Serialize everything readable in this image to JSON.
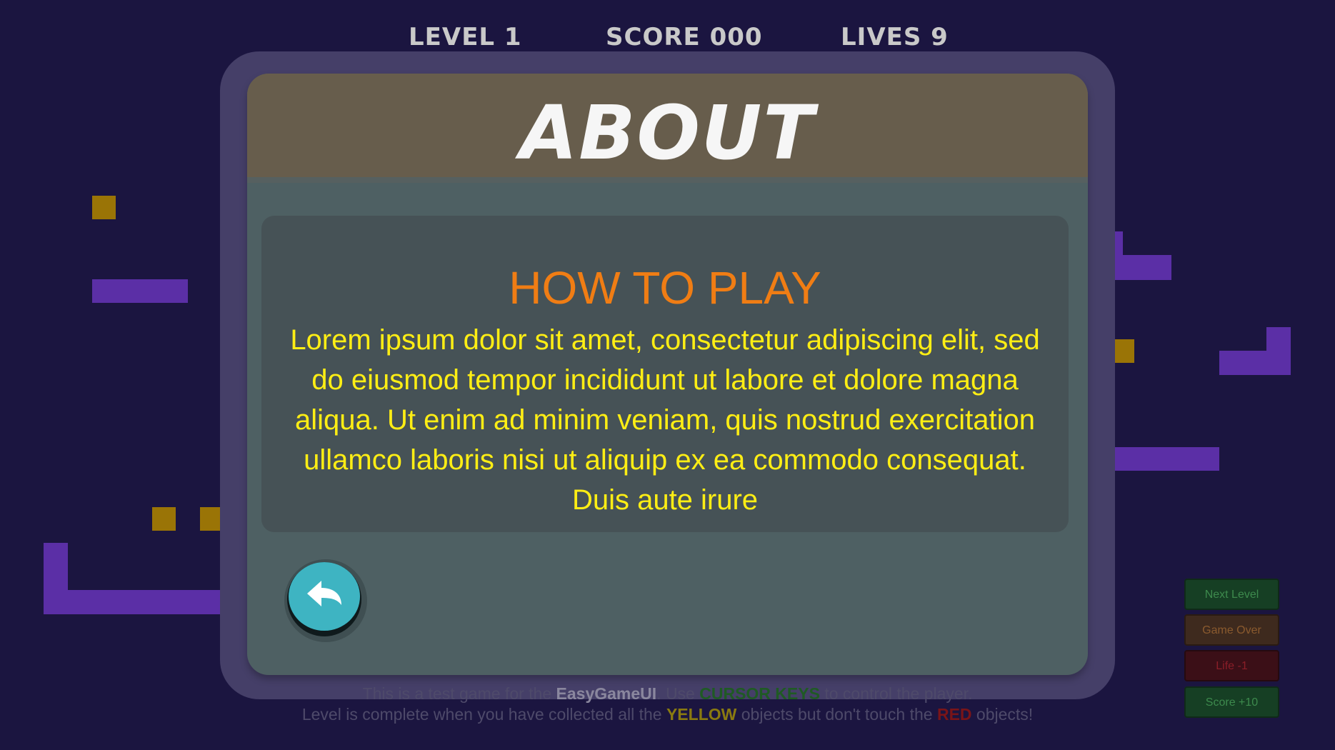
{
  "hud": {
    "level": "LEVEL 1",
    "score": "SCORE 000",
    "lives": "LIVES 9"
  },
  "dialog": {
    "title": "ABOUT",
    "heading": "HOW TO PLAY",
    "body": "Lorem ipsum dolor sit amet, consectetur adipiscing elit, sed do eiusmod tempor incididunt ut labore et dolore magna aliqua. Ut enim ad minim veniam, quis nostrud exercitation ullamco laboris nisi ut aliquip ex ea commodo consequat. Duis aute irure",
    "back_icon": "back-arrow-icon"
  },
  "info": {
    "line1": {
      "pre": "This is a test game for the ",
      "brand": "EasyGameUI",
      "mid": ". Use ",
      "keys": "CURSOR KEYS",
      "post": " to control the player."
    },
    "line2": {
      "pre": "Level is complete when you have collected all the ",
      "yellow": "YELLOW",
      "mid": " objects but don't touch the ",
      "red": "RED",
      "post": " objects!"
    }
  },
  "dev_buttons": [
    "Next Level",
    "Game Over",
    "Life -1",
    "Score +10"
  ],
  "colors": {
    "background": "#1b1540",
    "heading": "#f07d14",
    "body_text": "#ffee14",
    "back_button": "#3eb4c2"
  }
}
